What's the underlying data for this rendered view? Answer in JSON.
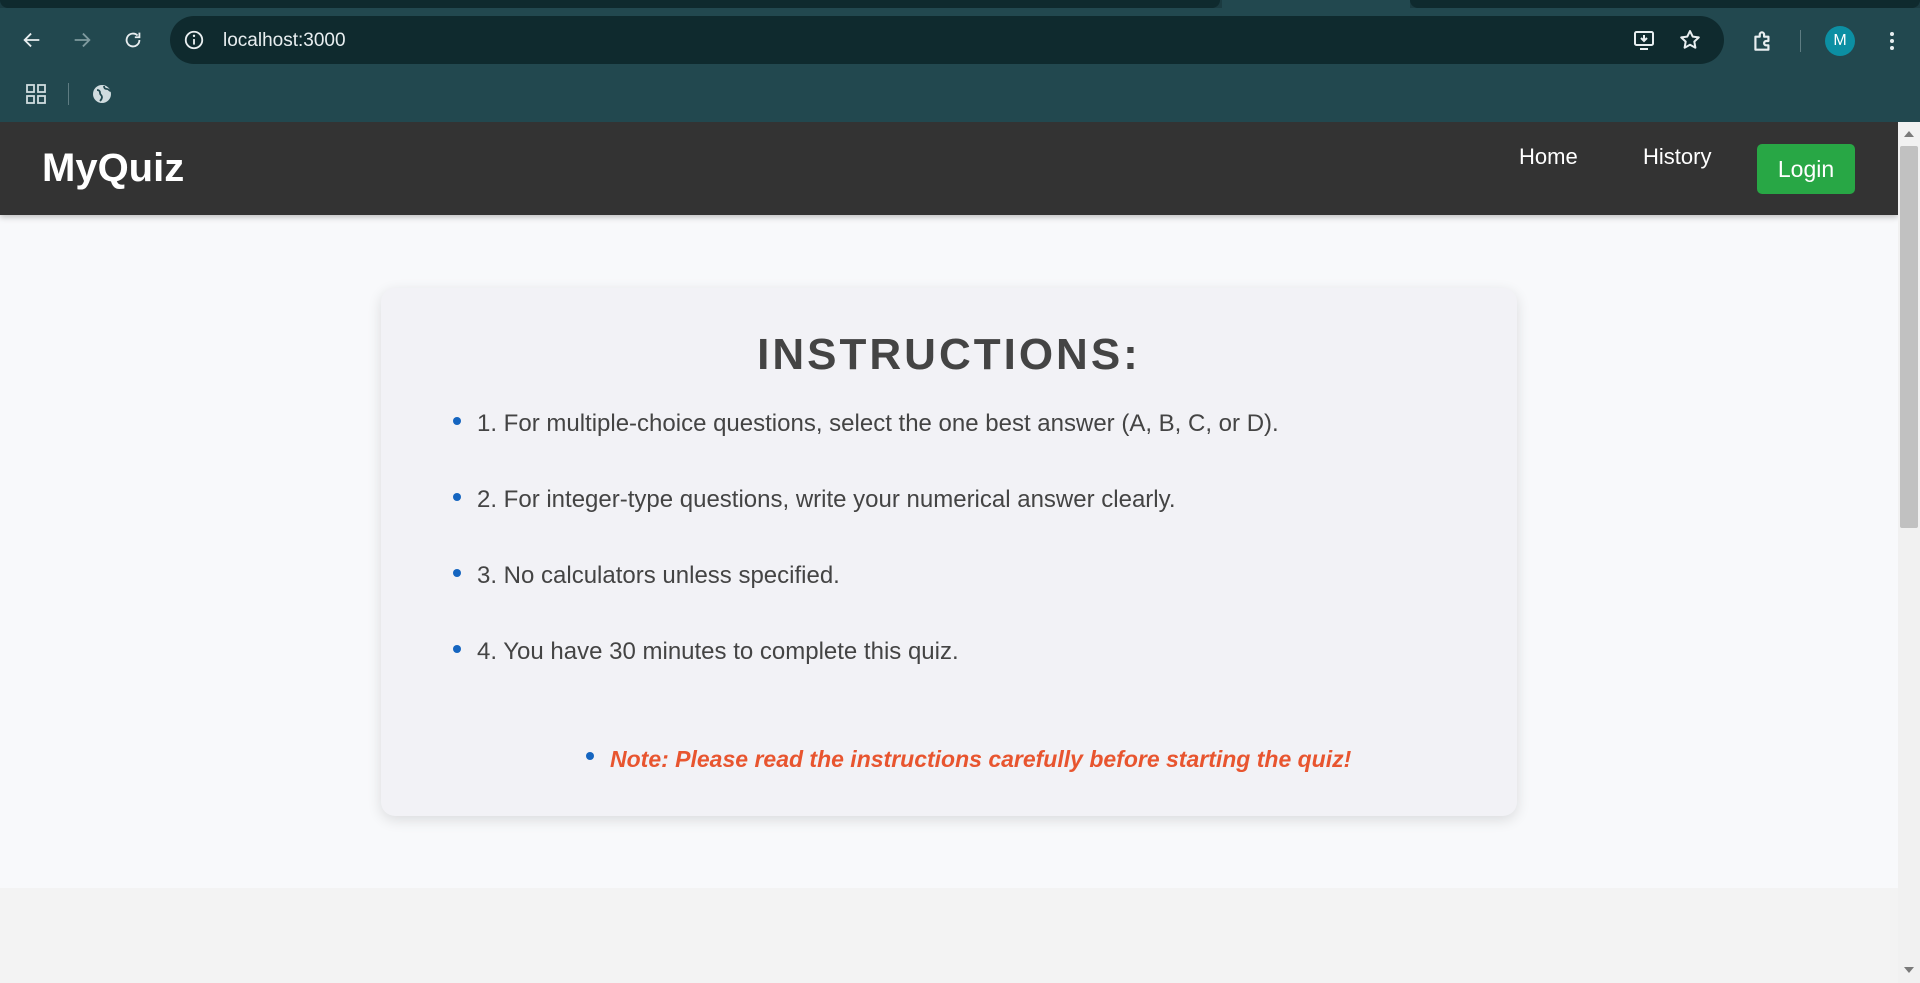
{
  "browser": {
    "url": "localhost:3000",
    "profile_initial": "M",
    "icons": {
      "back": "arrow-left-icon",
      "forward": "arrow-right-icon",
      "reload": "reload-icon",
      "site_info": "info-icon",
      "install": "install-app-icon",
      "bookmark": "star-icon",
      "extensions": "puzzle-icon",
      "menu": "kebab-menu-icon",
      "apps": "apps-grid-icon",
      "globe": "globe-icon"
    },
    "colors": {
      "frame": "#22484f",
      "omnibox": "#0f2a2e",
      "avatar": "#0c8fa3"
    }
  },
  "navbar": {
    "brand": "MyQuiz",
    "links": [
      "Home",
      "History"
    ],
    "login_label": "Login",
    "colors": {
      "background": "#333333",
      "login": "#28a745"
    }
  },
  "instructions": {
    "title": "INSTRUCTIONS:",
    "items": [
      "1. For multiple-choice questions, select the one best answer (A, B, C, or D).",
      "2. For integer-type questions, write your numerical answer clearly.",
      "3. No calculators unless specified.",
      "4. You have 30 minutes to complete this quiz."
    ],
    "note": "Note: Please read the instructions carefully before starting the quiz!",
    "colors": {
      "bullet": "#1565c0",
      "note": "#e8552f",
      "text": "#444444"
    }
  }
}
